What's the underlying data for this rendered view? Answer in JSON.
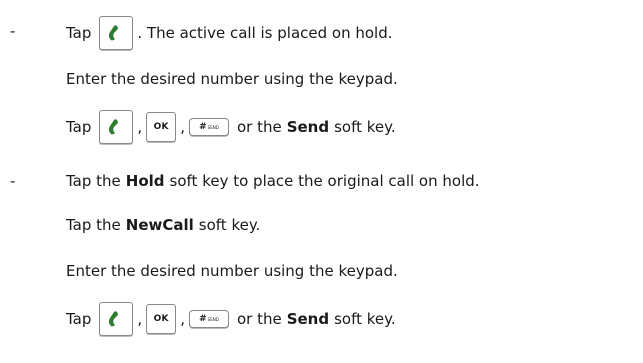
{
  "bullets": [
    "-",
    "-"
  ],
  "steps": {
    "s1_tap": "Tap",
    "s1_text": ". The active call is placed on hold.",
    "s2": "Enter the desired number using the keypad.",
    "s3_tap": "Tap",
    "s3_comma": ",",
    "s3_or": "or the",
    "s3_bold": "Send",
    "s3_end": "soft key.",
    "s4_tap": "Tap the",
    "s4_bold": "Hold",
    "s4_end": "soft key to place the original call on hold.",
    "s5_tap": "Tap the",
    "s5_bold": "NewCall",
    "s5_end": "soft key.",
    "s6": "Enter the desired number using the keypad.",
    "s7_tap": "Tap",
    "s7_comma": ",",
    "s7_or": "or the",
    "s7_bold": "Send",
    "s7_end": "soft key."
  },
  "keys": {
    "ok_label": "OK",
    "hash_label": "#",
    "hash_sub": "SEND"
  },
  "colors": {
    "phone_icon": "#2e7d32",
    "text": "#1a1a1a"
  },
  "icons": {
    "phone": "phone-handset-icon"
  }
}
